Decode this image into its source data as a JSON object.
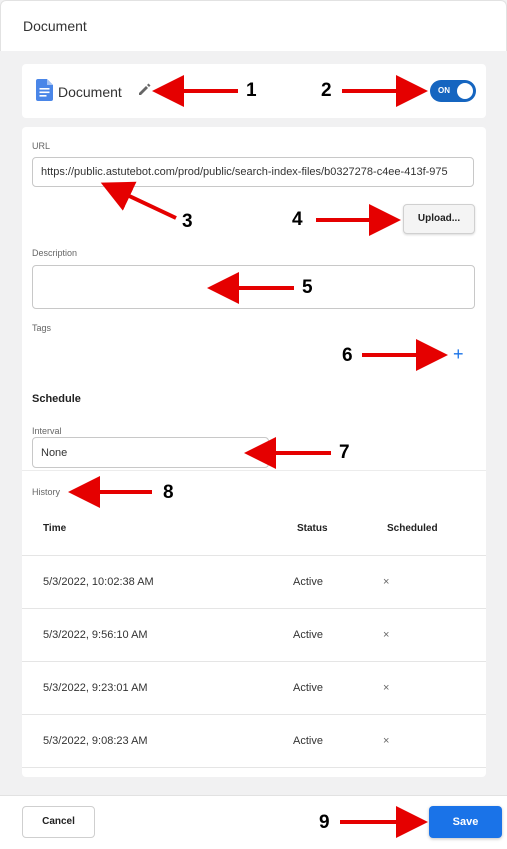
{
  "dialog": {
    "title": "Document"
  },
  "header": {
    "doc_label": "Document",
    "toggle_label": "ON"
  },
  "form": {
    "url_label": "URL",
    "url_value": "https://public.astutebot.com/prod/public/search-index-files/b0327278-c4ee-413f-975",
    "upload_label": "Upload...",
    "description_label": "Description",
    "description_value": "",
    "tags_label": "Tags",
    "schedule_title": "Schedule",
    "interval_label": "Interval",
    "interval_value": "None"
  },
  "history": {
    "label": "History",
    "columns": [
      "Time",
      "Status",
      "Scheduled"
    ],
    "rows": [
      {
        "time": "5/3/2022, 10:02:38 AM",
        "status": "Active",
        "scheduled": "×"
      },
      {
        "time": "5/3/2022, 9:56:10 AM",
        "status": "Active",
        "scheduled": "×"
      },
      {
        "time": "5/3/2022, 9:23:01 AM",
        "status": "Active",
        "scheduled": "×"
      },
      {
        "time": "5/3/2022, 9:08:23 AM",
        "status": "Active",
        "scheduled": "×"
      }
    ]
  },
  "footer": {
    "cancel_label": "Cancel",
    "save_label": "Save"
  },
  "annotations": [
    "1",
    "2",
    "3",
    "4",
    "5",
    "6",
    "7",
    "8",
    "9"
  ],
  "colors": {
    "accent": "#1a73e8",
    "toggle": "#1565c0",
    "arrow": "#e50000"
  },
  "icons": [
    "document-icon",
    "pencil-icon",
    "plus-icon",
    "chevron-down-icon"
  ]
}
